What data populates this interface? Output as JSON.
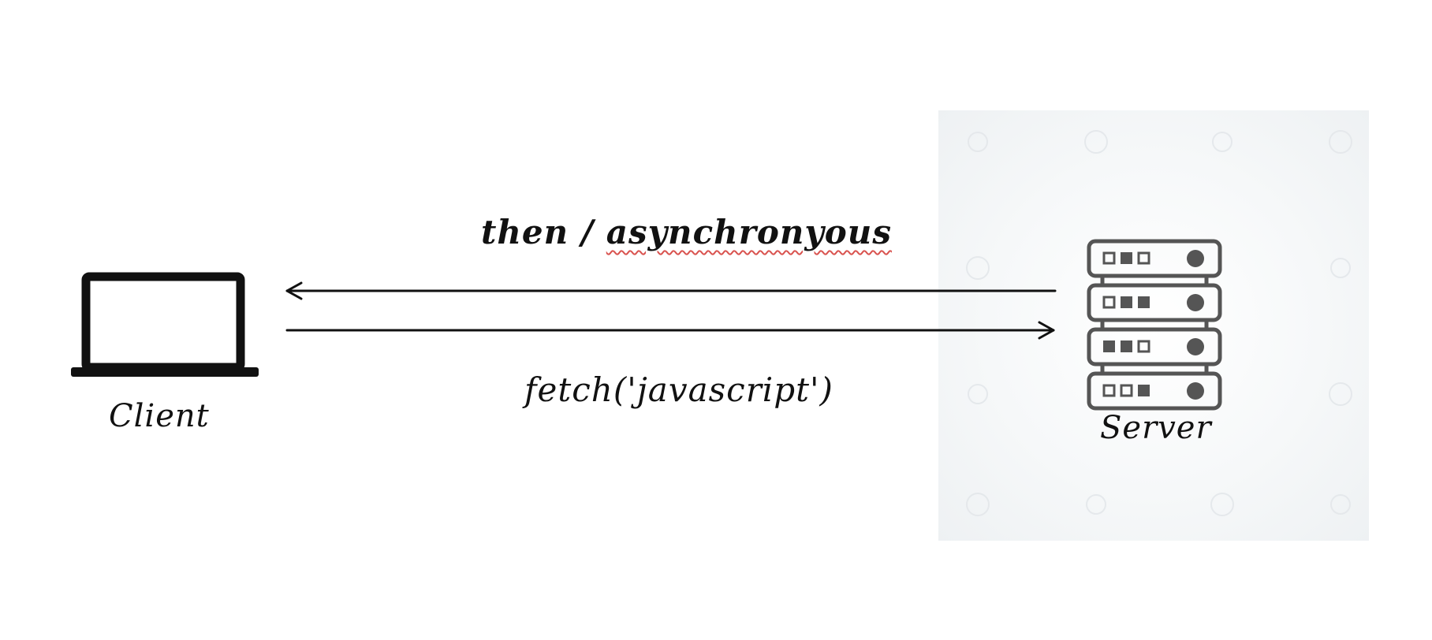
{
  "diagram": {
    "nodes": {
      "client": {
        "label": "Client",
        "icon": "laptop-icon"
      },
      "server": {
        "label": "Server",
        "icon": "server-rack-icon"
      }
    },
    "edges": {
      "response": {
        "from": "server",
        "to": "client",
        "label_part1": "then / ",
        "label_part2": "asynchronyous"
      },
      "request": {
        "from": "client",
        "to": "server",
        "label": "fetch('javascript')"
      }
    }
  },
  "colors": {
    "ink": "#111111",
    "server_icon": "#555555",
    "spellcheck_underline": "#d9534f",
    "panel_background": "#f2f5f7"
  }
}
